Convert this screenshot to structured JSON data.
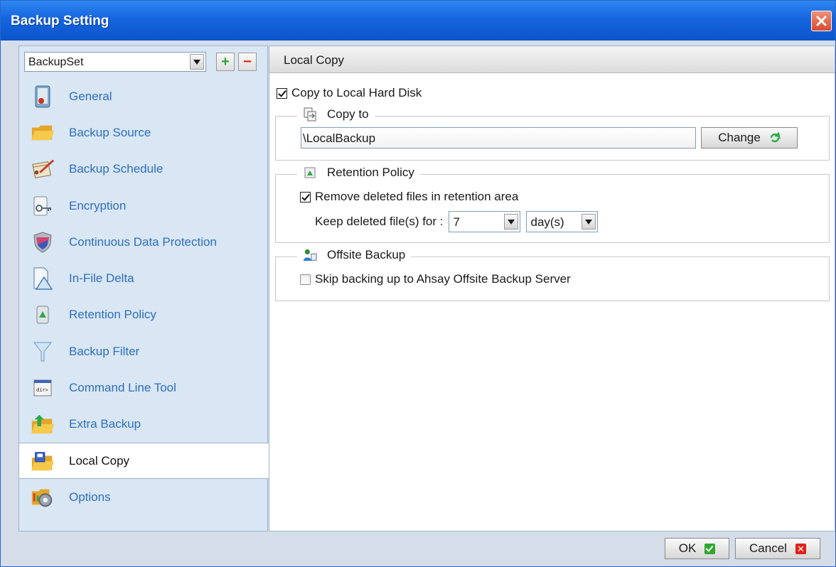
{
  "window": {
    "title": "Backup Setting",
    "close_icon": "close-icon"
  },
  "sidebar": {
    "backupset_value": "BackupSet",
    "add_label": "+",
    "remove_label": "−",
    "items": [
      {
        "label": "General",
        "icon": "general-icon",
        "active": false
      },
      {
        "label": "Backup Source",
        "icon": "folder-icon",
        "active": false
      },
      {
        "label": "Backup Schedule",
        "icon": "schedule-icon",
        "active": false
      },
      {
        "label": "Encryption",
        "icon": "key-icon",
        "active": false
      },
      {
        "label": "Continuous Data Protection",
        "icon": "shield-icon",
        "active": false
      },
      {
        "label": "In-File Delta",
        "icon": "delta-icon",
        "active": false
      },
      {
        "label": "Retention Policy",
        "icon": "recycle-bin-icon",
        "active": false
      },
      {
        "label": "Backup Filter",
        "icon": "filter-icon",
        "active": false
      },
      {
        "label": "Command Line Tool",
        "icon": "command-line-icon",
        "active": false
      },
      {
        "label": "Extra Backup",
        "icon": "extra-backup-icon",
        "active": false
      },
      {
        "label": "Local Copy",
        "icon": "local-copy-icon",
        "active": true
      },
      {
        "label": "Options",
        "icon": "options-icon",
        "active": false
      }
    ]
  },
  "main": {
    "header": "Local Copy",
    "copy_to_local": {
      "label": "Copy to Local Hard Disk",
      "checked": true
    },
    "copy_to": {
      "legend": "Copy to",
      "path": "\\LocalBackup",
      "change_label": "Change"
    },
    "retention": {
      "legend": "Retention Policy",
      "remove_label": "Remove deleted files in retention area",
      "remove_checked": true,
      "keep_label": "Keep deleted file(s) for :",
      "keep_value": "7",
      "unit_value": "day(s)"
    },
    "offsite": {
      "legend": "Offsite Backup",
      "skip_label": "Skip backing up to Ahsay Offsite Backup Server",
      "skip_checked": false
    }
  },
  "footer": {
    "ok_label": "OK",
    "cancel_label": "Cancel"
  },
  "colors": {
    "titlebar": "#1565df",
    "nav_link": "#2d6fbf",
    "panel_bg": "#d9e6f3"
  }
}
